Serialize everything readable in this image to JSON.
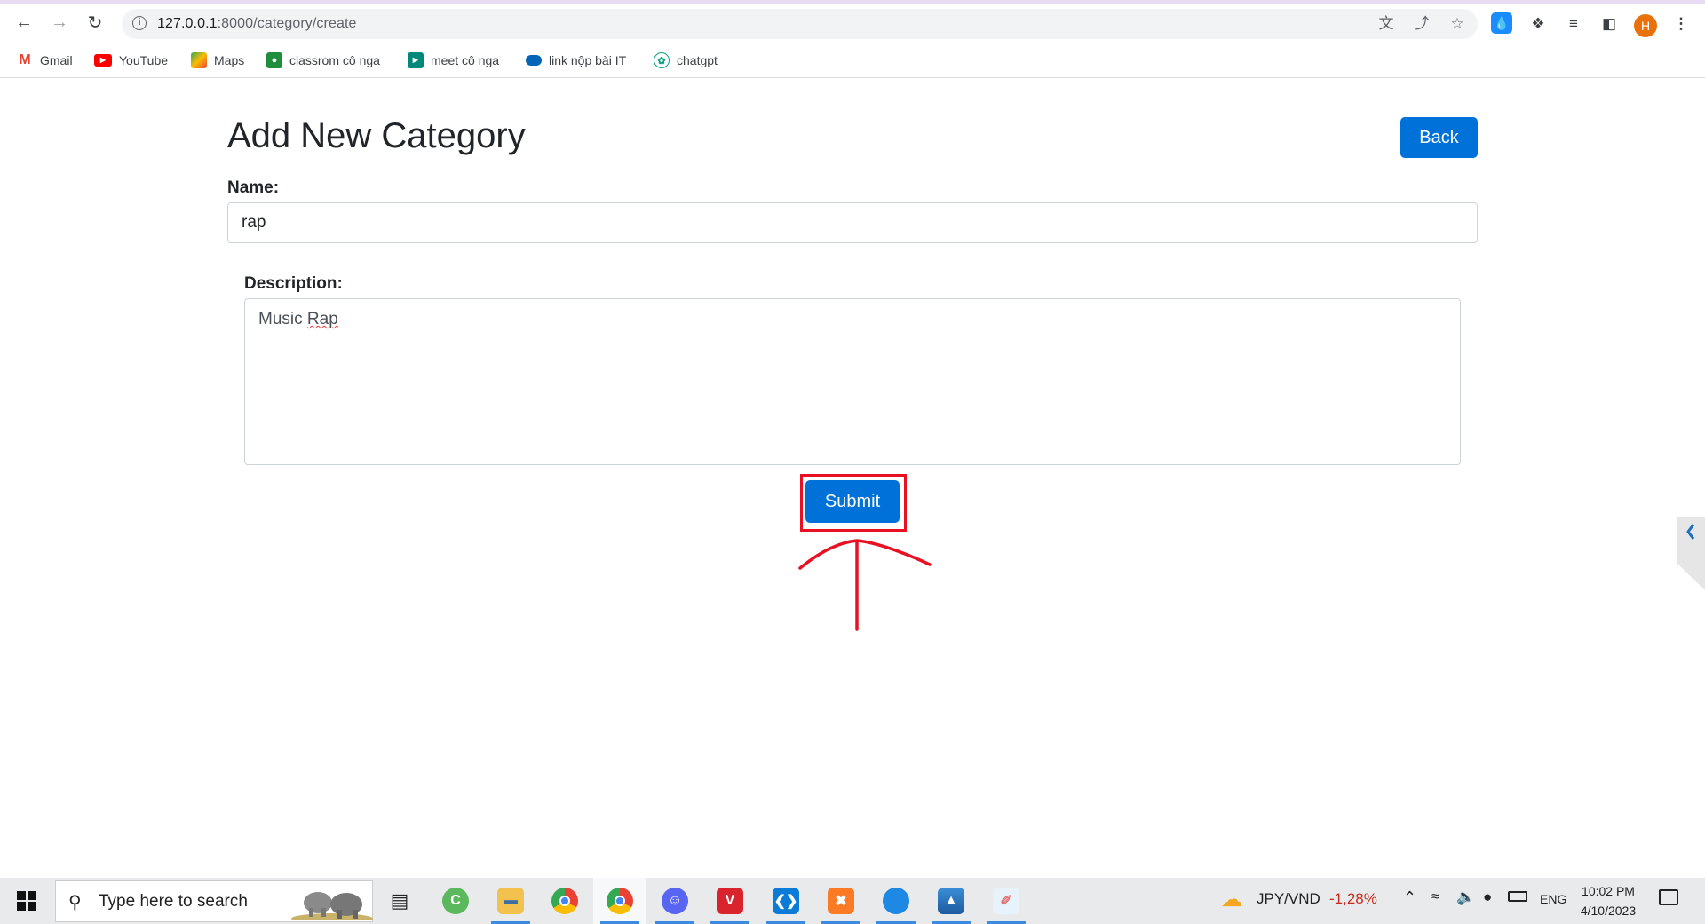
{
  "browser": {
    "url_host": "127.0.0.1",
    "url_path": ":8000/category/create",
    "profile_initial": "H",
    "bookmarks": [
      {
        "label": "Gmail",
        "icon": "gmail-icon",
        "color": "#ea4335"
      },
      {
        "label": "YouTube",
        "icon": "youtube-icon",
        "color": "#ff0000"
      },
      {
        "label": "Maps",
        "icon": "maps-icon",
        "color": "#34a853"
      },
      {
        "label": "classrom cô nga",
        "icon": "classroom-icon",
        "color": "#1e8e3e"
      },
      {
        "label": "meet cô nga",
        "icon": "meet-icon",
        "color": "#00897b"
      },
      {
        "label": "link nộp bài IT",
        "icon": "onedrive-icon",
        "color": "#0364b8"
      },
      {
        "label": "chatgpt",
        "icon": "chatgpt-icon",
        "color": "#10a37f"
      }
    ]
  },
  "page": {
    "title": "Add New Category",
    "back_label": "Back",
    "name_label": "Name:",
    "name_value": "rap",
    "description_label": "Description:",
    "description_word1": "Music ",
    "description_word2": "Rap",
    "submit_label": "Submit",
    "accent_color": "#0071d8",
    "annotation_color": "#e81123"
  },
  "taskbar": {
    "search_placeholder": "Type here to search",
    "apps": [
      "task-view",
      "app-green",
      "file-explorer",
      "chrome",
      "chrome-profile",
      "discord",
      "vscode-like",
      "vscode",
      "xampp",
      "remote-desktop",
      "photos",
      "paint"
    ],
    "ticker_label": "JPY/VND",
    "ticker_change": "-1,28%",
    "language": "ENG",
    "time": "10:02 PM",
    "date": "4/10/2023"
  }
}
